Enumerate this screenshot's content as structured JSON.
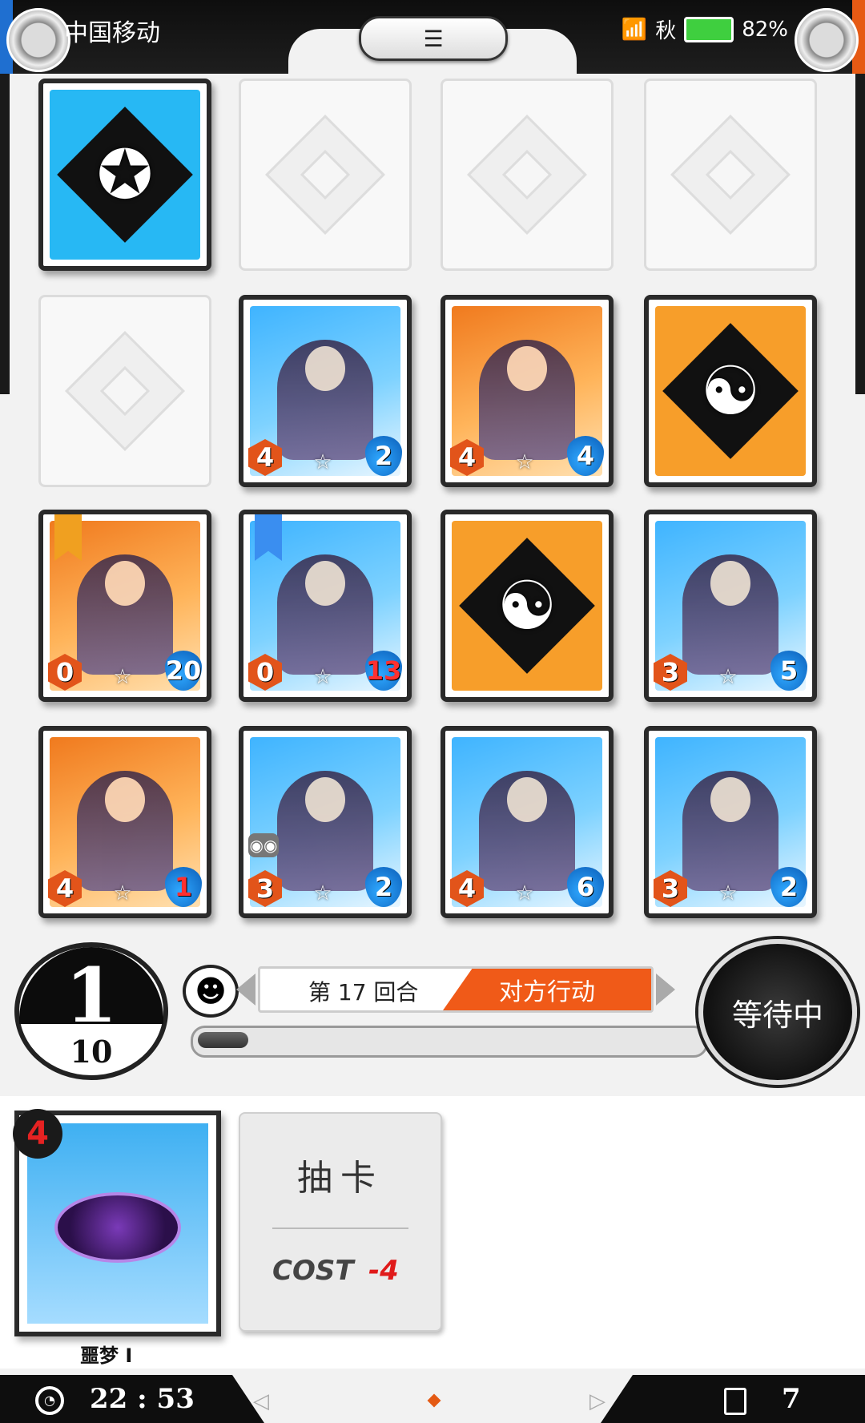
{
  "statusbar": {
    "operator": "中国移动",
    "time_label": "秋",
    "battery_percent": "82%",
    "menu_icon": "menu-lines-icon"
  },
  "board": {
    "row1": [
      {
        "type": "card_back",
        "style": "blue-back"
      },
      {
        "type": "empty"
      },
      {
        "type": "empty"
      },
      {
        "type": "empty"
      }
    ],
    "row2": [
      {
        "type": "empty"
      },
      {
        "type": "card",
        "style": "blue",
        "cost": "4",
        "hp": "2"
      },
      {
        "type": "card",
        "style": "orange",
        "cost": "4",
        "hp": "4"
      },
      {
        "type": "card_back",
        "style": "orange-back"
      }
    ],
    "row3": [
      {
        "type": "card",
        "style": "orange",
        "cost": "0",
        "hp": "20",
        "ribbon": "gold"
      },
      {
        "type": "card",
        "style": "blue",
        "cost": "0",
        "hp": "13",
        "ribbon": "blue"
      },
      {
        "type": "card_back",
        "style": "orange-back"
      },
      {
        "type": "card",
        "style": "blue",
        "cost": "3",
        "hp": "5"
      }
    ],
    "row4": [
      {
        "type": "card",
        "style": "orange",
        "cost": "4",
        "hp": "1"
      },
      {
        "type": "card",
        "style": "blue",
        "cost": "3",
        "hp": "2",
        "mask": true
      },
      {
        "type": "card",
        "style": "blue",
        "cost": "4",
        "hp": "6"
      },
      {
        "type": "card",
        "style": "blue",
        "cost": "3",
        "hp": "2"
      }
    ]
  },
  "turn": {
    "current": "1",
    "max": "10"
  },
  "round": {
    "label": "第 17 回合",
    "action": "对方行动"
  },
  "progress_fraction": 0.1,
  "wait_button": "等待中",
  "hand": {
    "card_cost": "4",
    "card_name": "噩梦 Ⅰ"
  },
  "draw": {
    "label": "抽卡",
    "cost_label": "COST",
    "cost_value": "-4"
  },
  "bottombar": {
    "time": "22 : 53",
    "deck_count": "7"
  },
  "colors": {
    "accent_orange": "#f05a18",
    "accent_blue": "#2fa8ff"
  }
}
